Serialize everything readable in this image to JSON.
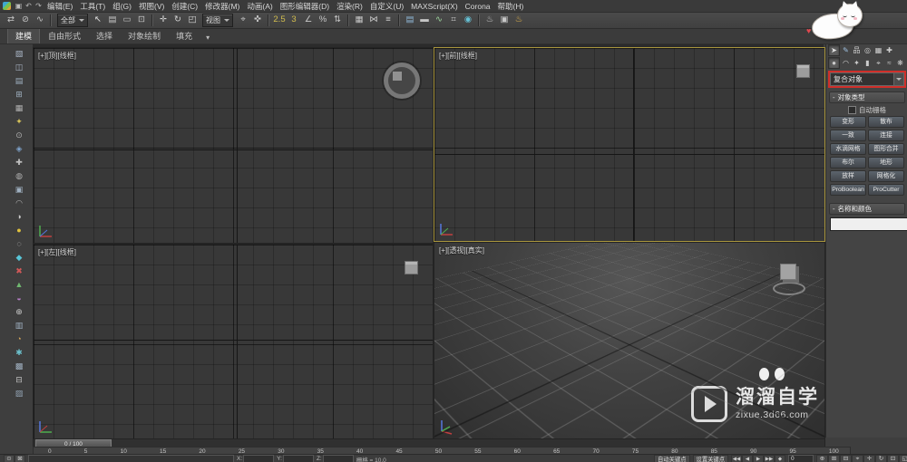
{
  "menu_bar": {
    "quick_icons": [
      {
        "name": "save-icon",
        "glyph": "▣"
      },
      {
        "name": "undo-icon",
        "glyph": "↶"
      },
      {
        "name": "redo-icon",
        "glyph": "↷"
      }
    ],
    "items": [
      "编辑(E)",
      "工具(T)",
      "组(G)",
      "视图(V)",
      "创建(C)",
      "修改器(M)",
      "动画(A)",
      "图形编辑器(D)",
      "渲染(R)",
      "自定义(U)",
      "MAXScript(X)",
      "Corona",
      "帮助(H)"
    ]
  },
  "toolbar": {
    "group_a": [
      {
        "name": "select-link-icon",
        "glyph": "⇄",
        "color": "#c6c6c6"
      },
      {
        "name": "unlink-icon",
        "glyph": "⊘",
        "color": "#c6c6c6"
      },
      {
        "name": "bind-spacewarp-icon",
        "glyph": "∿",
        "color": "#c6c6c6"
      },
      {
        "sep": true
      }
    ],
    "filter_value": "全部",
    "group_b": [
      {
        "name": "select-object-icon",
        "glyph": "↖",
        "color": "#e0e0e0"
      },
      {
        "name": "select-by-name-icon",
        "glyph": "▤",
        "color": "#c6c6c6"
      },
      {
        "name": "rect-select-region-icon",
        "glyph": "▭",
        "color": "#c6c6c6"
      },
      {
        "name": "window-crossing-icon",
        "glyph": "⊡",
        "color": "#c6c6c6"
      },
      {
        "sep": true
      },
      {
        "name": "move-icon",
        "glyph": "✛",
        "color": "#d6d6d6"
      },
      {
        "name": "rotate-icon",
        "glyph": "↻",
        "color": "#d6d6d6"
      },
      {
        "name": "scale-icon",
        "glyph": "◰",
        "color": "#d6d6d6"
      }
    ],
    "coord_value": "视图",
    "group_c": [
      {
        "name": "use-pivot-icon",
        "glyph": "⌖",
        "color": "#c6c6c6"
      },
      {
        "name": "select-manipulate-icon",
        "glyph": "✜",
        "color": "#c6c6c6"
      },
      {
        "sep": true
      },
      {
        "name": "snap-25-icon",
        "glyph": "2.5",
        "color": "#d2bd4e"
      },
      {
        "name": "snap-3-icon",
        "glyph": "3",
        "color": "#d2bd4e"
      },
      {
        "name": "angle-snap-icon",
        "glyph": "∠",
        "color": "#c6c6c6"
      },
      {
        "name": "percent-snap-icon",
        "glyph": "%",
        "color": "#c6c6c6"
      },
      {
        "name": "spinner-snap-icon",
        "glyph": "⇅",
        "color": "#c6c6c6"
      },
      {
        "sep": true
      },
      {
        "name": "named-selection-icon",
        "glyph": "▦",
        "color": "#c6c6c6"
      },
      {
        "name": "mirror-icon",
        "glyph": "⋈",
        "color": "#c6c6c6"
      },
      {
        "name": "align-icon",
        "glyph": "≡",
        "color": "#c6c6c6"
      },
      {
        "sep": true
      },
      {
        "name": "layer-manager-icon",
        "glyph": "▤",
        "color": "#8fb8d8"
      },
      {
        "name": "ribbon-toggle-icon",
        "glyph": "▬",
        "color": "#c6c6c6"
      },
      {
        "name": "curve-editor-icon",
        "glyph": "∿",
        "color": "#9fd89f"
      },
      {
        "name": "schematic-view-icon",
        "glyph": "⌗",
        "color": "#c6c6c6"
      },
      {
        "name": "material-editor-icon",
        "glyph": "◉",
        "color": "#66c2d6"
      },
      {
        "sep": true
      },
      {
        "name": "render-setup-icon",
        "glyph": "♨",
        "color": "#c8c8c8"
      },
      {
        "name": "rendered-frame-icon",
        "glyph": "▣",
        "color": "#c8c8c8"
      },
      {
        "name": "render-production-icon",
        "glyph": "♨",
        "color": "#e8b84a"
      }
    ]
  },
  "ribbon": {
    "tabs": [
      {
        "label": "建模",
        "active": true
      },
      {
        "label": "自由形式",
        "active": false
      },
      {
        "label": "选择",
        "active": false
      },
      {
        "label": "对象绘制",
        "active": false
      },
      {
        "label": "填充",
        "active": false
      }
    ],
    "more_glyph": "▾"
  },
  "left_toolbar": {
    "icons": [
      {
        "glyph": "▧",
        "color": "#a8b4c4"
      },
      {
        "glyph": "◫",
        "color": "#a8b4c4"
      },
      {
        "glyph": "▤",
        "color": "#9fb0c0"
      },
      {
        "glyph": "⊞",
        "color": "#9fb0c0"
      },
      {
        "glyph": "▦",
        "color": "#b0b0b0"
      },
      {
        "glyph": "✦",
        "color": "#d6c25a"
      },
      {
        "glyph": "⊙",
        "color": "#b0b0b0"
      },
      {
        "glyph": "◈",
        "color": "#7fa3cc"
      },
      {
        "glyph": "✚",
        "color": "#c0c0c0"
      },
      {
        "glyph": "◍",
        "color": "#b0b0b0"
      },
      {
        "glyph": "▣",
        "color": "#9fb0c0"
      },
      {
        "glyph": "◠",
        "color": "#b0b0b0"
      },
      {
        "glyph": "◑",
        "color": "#cccccc"
      },
      {
        "glyph": "●",
        "color": "#e0c23e"
      },
      {
        "glyph": "◌",
        "color": "#d8d8d8"
      },
      {
        "glyph": "◆",
        "color": "#58c6d8"
      },
      {
        "glyph": "✖",
        "color": "#d05858"
      },
      {
        "glyph": "▲",
        "color": "#70b870"
      },
      {
        "glyph": "◒",
        "color": "#b87fc8"
      },
      {
        "glyph": "⊕",
        "color": "#c8c8c8"
      },
      {
        "glyph": "▥",
        "color": "#9fb0c0"
      },
      {
        "glyph": "◔",
        "color": "#d8a85a"
      },
      {
        "glyph": "✱",
        "color": "#6cc0cc"
      },
      {
        "glyph": "▩",
        "color": "#a0b0c0"
      },
      {
        "glyph": "⊟",
        "color": "#c0c0c0"
      },
      {
        "glyph": "▨",
        "color": "#90a0b0"
      }
    ]
  },
  "viewports": {
    "top_left_label": "[+][顶][线框]",
    "top_right_label": "[+][前][线框]",
    "bottom_left_label": "[+][左][线框]",
    "bottom_right_label": "[+][透视][真实]"
  },
  "command_panel": {
    "tabs": [
      {
        "name": "tab-create",
        "glyph": "➤",
        "color": "#e4e4e4",
        "active": true
      },
      {
        "name": "tab-modify",
        "glyph": "✎",
        "color": "#9fc0e0",
        "active": false
      },
      {
        "name": "tab-hierarchy",
        "glyph": "品",
        "color": "#d0d0d0",
        "active": false
      },
      {
        "name": "tab-motion",
        "glyph": "◎",
        "color": "#d0d0d0",
        "active": false
      },
      {
        "name": "tab-display",
        "glyph": "▦",
        "color": "#d0d0d0",
        "active": false
      },
      {
        "name": "tab-utilities",
        "glyph": "✚",
        "color": "#d0d0d0",
        "active": false
      }
    ],
    "categories": [
      {
        "name": "cat-geometry",
        "glyph": "●",
        "active": true
      },
      {
        "name": "cat-shapes",
        "glyph": "◠",
        "active": false
      },
      {
        "name": "cat-lights",
        "glyph": "✦",
        "active": false
      },
      {
        "name": "cat-cameras",
        "glyph": "▮",
        "active": false
      },
      {
        "name": "cat-helpers",
        "glyph": "⌖",
        "active": false
      },
      {
        "name": "cat-spacewarps",
        "glyph": "≈",
        "active": false
      },
      {
        "name": "cat-systems",
        "glyph": "❋",
        "active": false
      }
    ],
    "category_dropdown_value": "复合对象",
    "rollout_collapse_glyph": "-",
    "object_type": {
      "title": "对象类型",
      "autogrid_label": "自动栅格",
      "buttons": [
        "变形",
        "散布",
        "一致",
        "连接",
        "水滴网格",
        "图形合并",
        "布尔",
        "地形",
        "放样",
        "网格化",
        "ProBoolean",
        "ProCutter"
      ]
    },
    "name_color": {
      "title": "名称和颜色",
      "name_value": "",
      "swatch_color": "#e23fc0"
    }
  },
  "timeline": {
    "slider_label": "0 / 100",
    "ticks": [
      "0",
      "5",
      "10",
      "15",
      "20",
      "25",
      "30",
      "35",
      "40",
      "45",
      "50",
      "55",
      "60",
      "65",
      "70",
      "75",
      "80",
      "85",
      "90",
      "95",
      "100"
    ]
  },
  "status_bar": {
    "left_icons": [
      {
        "name": "isolate-selection-icon",
        "glyph": "⊙"
      },
      {
        "name": "selection-lock-icon",
        "glyph": "⊠"
      }
    ],
    "coord_labels": [
      "X:",
      "Y:",
      "Z:"
    ],
    "grid_label": "栅格 = 10.0",
    "autokey_label": "自动关键点",
    "setkey_label": "设置关键点",
    "playback_icons": [
      {
        "name": "go-to-start-icon",
        "glyph": "◀◀"
      },
      {
        "name": "prev-frame-icon",
        "glyph": "◀"
      },
      {
        "name": "play-icon",
        "glyph": "▶"
      },
      {
        "name": "next-frame-icon",
        "glyph": "▶▶"
      },
      {
        "name": "key-mode-icon",
        "glyph": "◆"
      }
    ],
    "frame_value": "0",
    "nav_icons": [
      {
        "name": "zoom-icon",
        "glyph": "⊕"
      },
      {
        "name": "zoom-all-icon",
        "glyph": "⊞"
      },
      {
        "name": "zoom-extents-icon",
        "glyph": "⊟"
      },
      {
        "name": "zoom-extents-all-icon",
        "glyph": "⌖"
      },
      {
        "name": "pan-icon",
        "glyph": "✛"
      },
      {
        "name": "orbit-icon",
        "glyph": "↻"
      },
      {
        "name": "zoom-region-icon",
        "glyph": "⊡"
      },
      {
        "name": "maximize-viewport-icon",
        "glyph": "◱"
      }
    ]
  },
  "watermark": {
    "brand": "溜溜自学",
    "url": "zixue.3d66.com"
  },
  "mascot": {
    "heart": "♥"
  }
}
